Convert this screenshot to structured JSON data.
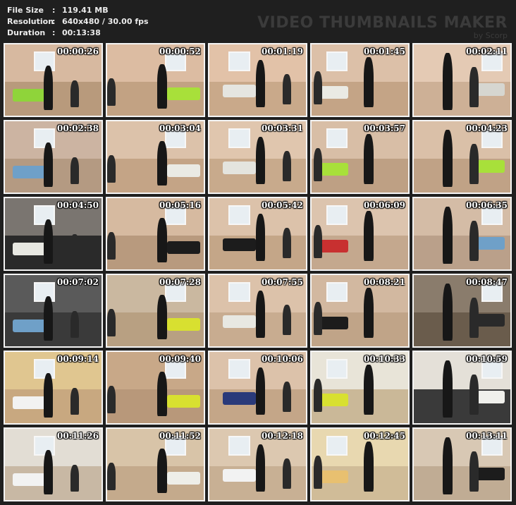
{
  "info": {
    "file_size_label": "File Size",
    "file_size_value": "119.41 MB",
    "resolution_label": "Resolution",
    "resolution_value": "640x480 / 30.00 fps",
    "duration_label": "Duration",
    "duration_value": "00:13:38",
    "separator": ":"
  },
  "watermark": {
    "title": "VIDEO THUMBNAILS MAKER",
    "subtitle": "by Scorp"
  },
  "thumbnails": [
    {
      "time": "00:00:26",
      "wall": "#d7b9a0",
      "floor": "#b89a7c",
      "accent": "#8fd43a"
    },
    {
      "time": "00:00:52",
      "wall": "#dcbca2",
      "floor": "#c2a283",
      "accent": "#a8e03a"
    },
    {
      "time": "00:01:19",
      "wall": "#e2c2a8",
      "floor": "#c9a98a",
      "accent": "#e5e5e0"
    },
    {
      "time": "00:01:45",
      "wall": "#dcc0a8",
      "floor": "#c4a486",
      "accent": "#eaeae4"
    },
    {
      "time": "00:02:11",
      "wall": "#e4cab4",
      "floor": "#cdb096",
      "accent": "#d6d6d0"
    },
    {
      "time": "00:02:38",
      "wall": "#ccb4a2",
      "floor": "#b49a82",
      "accent": "#6fa0c8"
    },
    {
      "time": "00:03:04",
      "wall": "#dcc2aa",
      "floor": "#c4a486",
      "accent": "#eaeae4"
    },
    {
      "time": "00:03:31",
      "wall": "#e0c6ae",
      "floor": "#c8aa8c",
      "accent": "#e4e4de"
    },
    {
      "time": "00:03:57",
      "wall": "#d8bea6",
      "floor": "#bea084",
      "accent": "#a8e03a"
    },
    {
      "time": "00:04:23",
      "wall": "#dac0a8",
      "floor": "#c0a286",
      "accent": "#a8e03a"
    },
    {
      "time": "00:04:50",
      "wall": "#7a7570",
      "floor": "#2a2a2a",
      "accent": "#e8e8e2"
    },
    {
      "time": "00:05:16",
      "wall": "#d6baa0",
      "floor": "#b89a7e",
      "accent": "#1c1c1c"
    },
    {
      "time": "00:05:42",
      "wall": "#dcc2aa",
      "floor": "#c4a688",
      "accent": "#1c1c1c"
    },
    {
      "time": "00:06:09",
      "wall": "#dcc4ae",
      "floor": "#c4a88e",
      "accent": "#c83030"
    },
    {
      "time": "00:06:35",
      "wall": "#d4bca6",
      "floor": "#baa08a",
      "accent": "#6fa0c8"
    },
    {
      "time": "00:07:02",
      "wall": "#5a5a5a",
      "floor": "#3a3a3a",
      "accent": "#6fa0c8"
    },
    {
      "time": "00:07:28",
      "wall": "#cab8a0",
      "floor": "#b8a082",
      "accent": "#d8e030"
    },
    {
      "time": "00:07:55",
      "wall": "#dcc2aa",
      "floor": "#c8ac90",
      "accent": "#e8e8e2"
    },
    {
      "time": "00:08:21",
      "wall": "#d2b8a0",
      "floor": "#c0a488",
      "accent": "#1c1c1c"
    },
    {
      "time": "00:08:47",
      "wall": "#8a7c6c",
      "floor": "#6a5c4c",
      "accent": "#2a2a2a"
    },
    {
      "time": "00:09:14",
      "wall": "#e0c690",
      "floor": "#c8a880",
      "accent": "#f2f2f2"
    },
    {
      "time": "00:09:40",
      "wall": "#c8a888",
      "floor": "#b8987a",
      "accent": "#d8e030"
    },
    {
      "time": "00:10:06",
      "wall": "#dcc2aa",
      "floor": "#c4a688",
      "accent": "#2a3a7a"
    },
    {
      "time": "00:10:33",
      "wall": "#e8e4d8",
      "floor": "#cab898",
      "accent": "#d8e030"
    },
    {
      "time": "00:10:59",
      "wall": "#e4e0d8",
      "floor": "#3a3a3a",
      "accent": "#f0f0ec"
    },
    {
      "time": "00:11:26",
      "wall": "#e2ddd4",
      "floor": "#c8b8a4",
      "accent": "#f2f2f2"
    },
    {
      "time": "00:11:52",
      "wall": "#d8c4a8",
      "floor": "#c4aa8c",
      "accent": "#eeeee8"
    },
    {
      "time": "00:12:18",
      "wall": "#dcc8b0",
      "floor": "#c8b094",
      "accent": "#f2f2f2"
    },
    {
      "time": "00:12:45",
      "wall": "#e8d8b0",
      "floor": "#d0bc98",
      "accent": "#e8c070"
    },
    {
      "time": "00:13:11",
      "wall": "#d8c8b4",
      "floor": "#c0ac94",
      "accent": "#1c1c1c"
    }
  ]
}
